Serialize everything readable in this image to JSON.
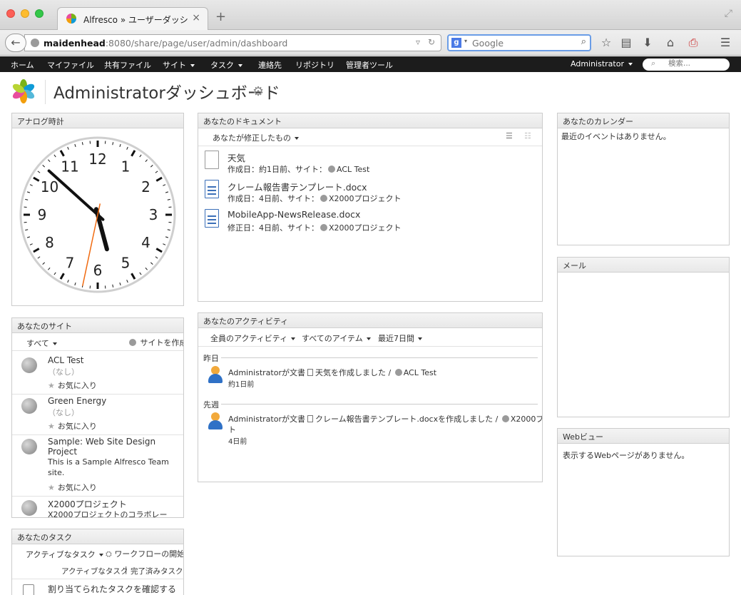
{
  "browser": {
    "tab_title": "Alfresco » ユーザーダッシ…",
    "url_host": "maidenhead",
    "url_path": ":8080/share/page/user/admin/dashboard",
    "search_placeholder": "Google"
  },
  "nav": {
    "items": [
      "ホーム",
      "マイファイル",
      "共有ファイル",
      "サイト",
      "タスク",
      "連絡先",
      "リポジトリ",
      "管理者ツール"
    ],
    "user": "Administrator",
    "search_placeholder": "検索..."
  },
  "page": {
    "title": "Administratorダッシュボード"
  },
  "clock": {
    "title": "アナログ時計",
    "numbers": [
      "12",
      "1",
      "2",
      "3",
      "4",
      "5",
      "6",
      "7",
      "8",
      "9",
      "10",
      "11"
    ],
    "hour": 5.5,
    "minute": 52,
    "second": 32
  },
  "documents": {
    "title": "あなたのドキュメント",
    "filter": "あなたが修正したもの",
    "items": [
      {
        "name": "天気",
        "meta": "作成日：約1日前、サイト：",
        "site": "ACL Test",
        "icon": "blank-doc-icon"
      },
      {
        "name": "クレーム報告書テンプレート.docx",
        "meta": "作成日：4日前、サイト：",
        "site": "X2000プロジェクト",
        "icon": "word-doc-icon"
      },
      {
        "name": "MobileApp-NewsRelease.docx",
        "meta": "修正日：4日前、サイト：",
        "site": "X2000プロジェクト",
        "icon": "word-doc-icon"
      }
    ]
  },
  "calendar": {
    "title": "あなたのカレンダー",
    "empty": "最近のイベントはありません。"
  },
  "mail": {
    "title": "メール"
  },
  "webview": {
    "title": "Webビュー",
    "empty": "表示するWebページがありません。"
  },
  "sites": {
    "title": "あなたのサイト",
    "filter": "すべて",
    "create": "サイトを作成",
    "favorite_label": "お気に入り",
    "items": [
      {
        "name": "ACL Test",
        "desc": "（なし）"
      },
      {
        "name": "Green Energy",
        "desc": "（なし）"
      },
      {
        "name": "Sample: Web Site Design",
        "name2": "Project",
        "desc": "This is a Sample Alfresco Team",
        "desc2": "site."
      },
      {
        "name": "X2000プロジェクト",
        "desc": "X2000プロジェクトのコラボレー"
      }
    ]
  },
  "activities": {
    "title": "あなたのアクティビティ",
    "filters": [
      "全員のアクティビティ",
      "すべてのアイテム",
      "最近7日間"
    ],
    "groups": [
      {
        "label": "昨日",
        "text": "Administratorが文書",
        "doc": "天気を作成しました / ",
        "site": "ACL Test",
        "time": "約1日前"
      },
      {
        "label": "先週",
        "text": "Administratorが文書",
        "doc": "クレーム報告書テンプレート.docxを作成しました / ",
        "site": "X2000プロジェク",
        "site2": "ト",
        "time": "4日前"
      }
    ]
  },
  "tasks": {
    "title": "あなたのタスク",
    "filter": "アクティブなタスク",
    "start_workflow": "ワークフローの開始",
    "links": [
      "アクティブなタスク",
      "完了済みタスク"
    ],
    "separator": "|",
    "item": "割り当てられたタスクを確認する"
  }
}
